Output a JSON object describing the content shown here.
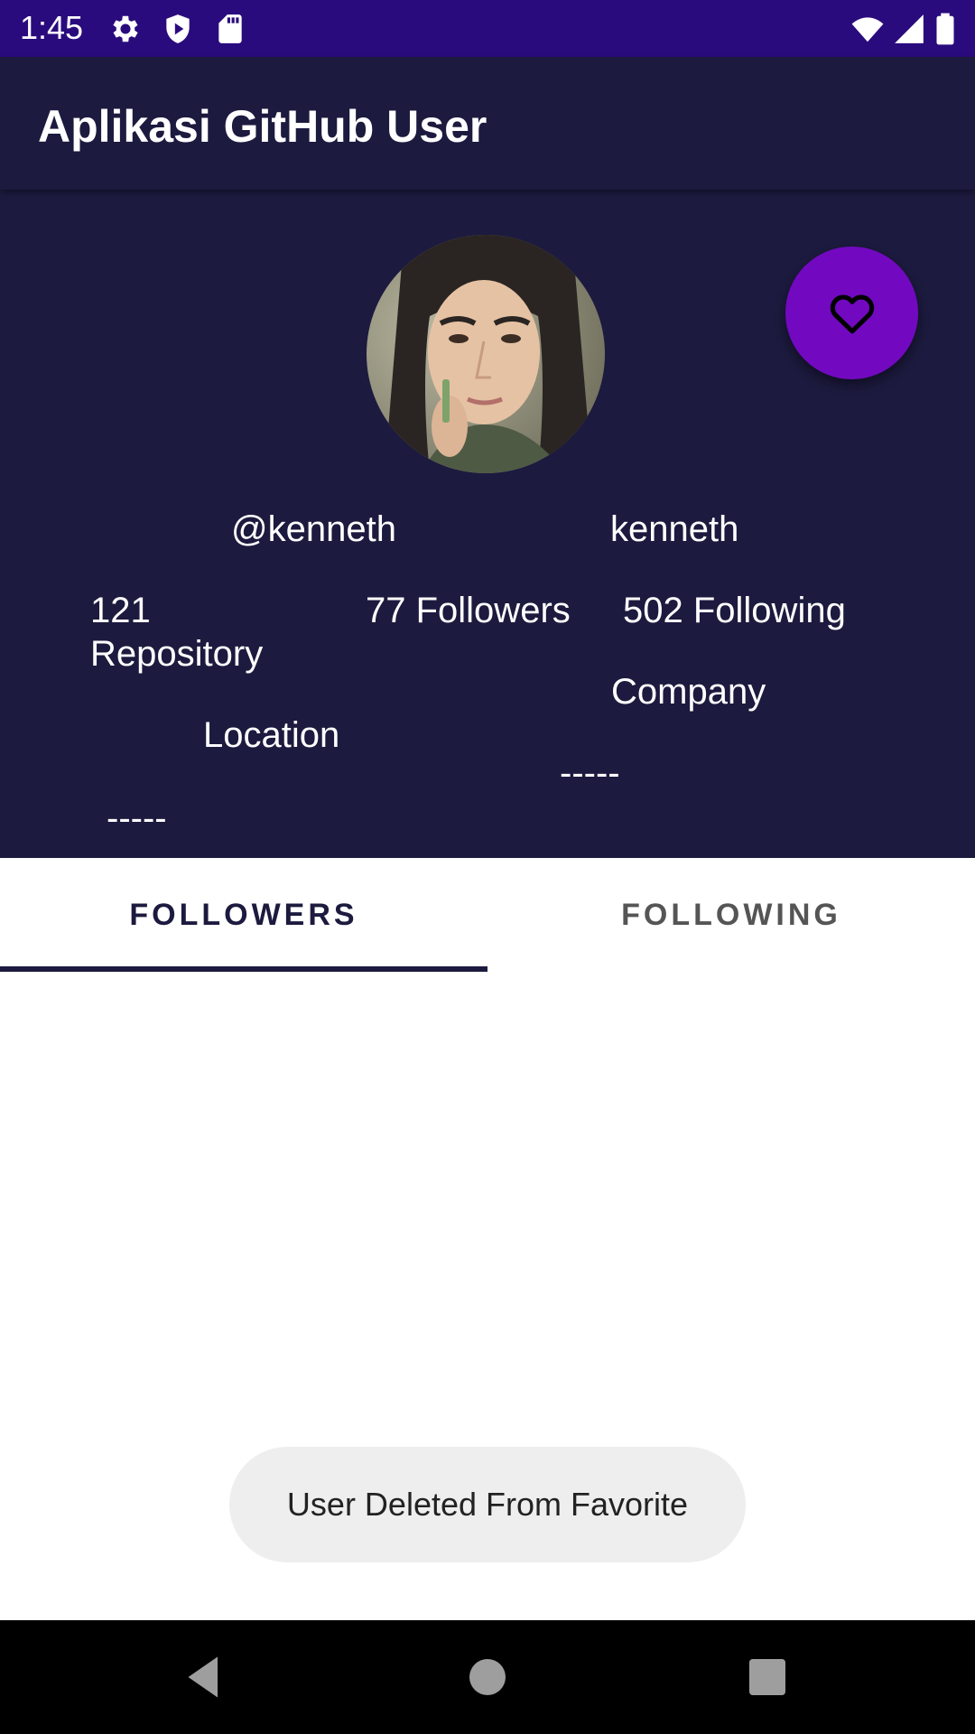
{
  "status_bar": {
    "time": "1:45",
    "left_icons": [
      "gear-icon",
      "shield-play-icon",
      "sd-card-icon"
    ],
    "right_icons": [
      "wifi-icon",
      "signal-icon",
      "battery-icon"
    ],
    "background_color": "#2a0b7d"
  },
  "app_bar": {
    "title": "Aplikasi GitHub User",
    "background_color": "#1c1a3e"
  },
  "profile": {
    "username": "@kenneth",
    "name": "kenneth",
    "repository_count": "121",
    "repository_label": "Repository",
    "followers": "77 Followers",
    "following": "502 Following",
    "company_label": "Company",
    "company_value": "-----",
    "location_label": "Location",
    "location_value": "-----",
    "favorite_button_icon": "heart-outline-icon",
    "favorite_button_color": "#7209c0"
  },
  "tabs": [
    {
      "label": "FOLLOWERS",
      "selected": true
    },
    {
      "label": "FOLLOWING",
      "selected": false
    }
  ],
  "toast": {
    "message": "User Deleted From Favorite"
  },
  "nav_bar": {
    "buttons": [
      "back-icon",
      "home-icon",
      "recents-icon"
    ]
  }
}
